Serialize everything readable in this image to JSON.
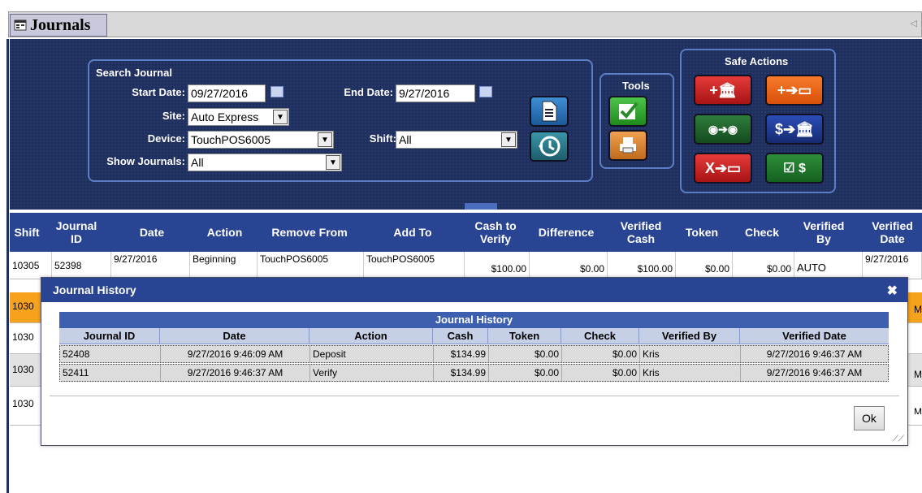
{
  "window": {
    "title": "Journals"
  },
  "search": {
    "group_label": "Search Journal",
    "start_date_label": "Start Date:",
    "start_date_value": "09/27/2016",
    "end_date_label": "End Date:",
    "end_date_value": "9/27/2016",
    "site_label": "Site:",
    "site_value": "Auto Express",
    "device_label": "Device:",
    "device_value": "TouchPOS6005",
    "shift_label": "Shift:",
    "shift_value": "All",
    "show_journals_label": "Show Journals:",
    "show_journals_value": "All"
  },
  "tools": {
    "label": "Tools"
  },
  "safe_actions": {
    "label": "Safe Actions"
  },
  "table": {
    "headers": [
      "Shift",
      "Journal ID",
      "Date",
      "Action",
      "Remove From",
      "Add To",
      "Cash to Verify",
      "Difference",
      "Verified Cash",
      "Token",
      "Check",
      "Verified By",
      "Verified Date"
    ],
    "rows": [
      [
        "10305",
        "52398",
        "9/27/2016",
        "Beginning",
        "TouchPOS6005",
        "TouchPOS6005",
        "$100.00",
        "$0.00",
        "$100.00",
        "$0.00",
        "$0.00",
        "AUTO",
        "9/27/2016"
      ],
      [
        "1030",
        "",
        "",
        "",
        "",
        "",
        "",
        "",
        "",
        "",
        "",
        "",
        "M"
      ],
      [
        "1030",
        "",
        "",
        "",
        "",
        "",
        "",
        "",
        "",
        "",
        "",
        "",
        ""
      ],
      [
        "1030",
        "",
        "",
        "",
        "",
        "",
        "",
        "",
        "",
        "",
        "",
        "",
        "M"
      ],
      [
        "1030",
        "",
        "",
        "",
        "",
        "",
        "",
        "",
        "",
        "",
        "",
        "",
        "M"
      ]
    ]
  },
  "modal": {
    "title": "Journal History",
    "grid_title": "Journal History",
    "columns": [
      "Journal ID",
      "Date",
      "Action",
      "Cash",
      "Token",
      "Check",
      "Verified By",
      "Verified Date"
    ],
    "rows": [
      [
        "52408",
        "9/27/2016 9:46:09 AM",
        "Deposit",
        "$134.99",
        "$0.00",
        "$0.00",
        "Kris",
        "9/27/2016 9:46:37 AM"
      ],
      [
        "52411",
        "9/27/2016 9:46:37 AM",
        "Verify",
        "$134.99",
        "$0.00",
        "$0.00",
        "Kris",
        "9/27/2016 9:46:37 AM"
      ]
    ],
    "ok_label": "Ok",
    "close_glyph": "✖"
  },
  "colors": {
    "header_blue": "#2a4494",
    "panel_navy": "#1f2f5e",
    "highlight_orange": "#f7a21c"
  }
}
